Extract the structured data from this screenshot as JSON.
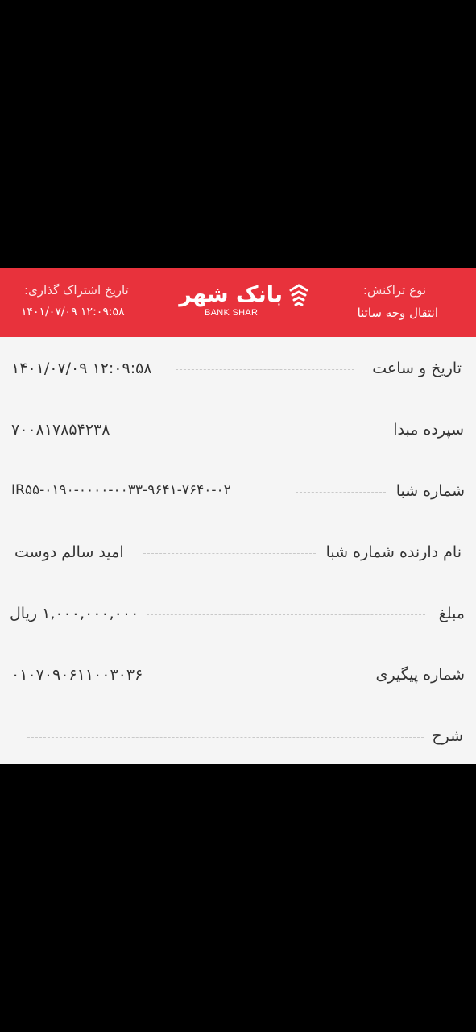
{
  "header": {
    "transaction_type_label": "نوع تراکنش:",
    "transaction_type_value": "انتقال وجه ساتنا",
    "share_date_label": "تاریخ اشتراک گذاری:",
    "share_date_value": "۱۴۰۱/۰۷/۰۹ ۱۲:۰۹:۵۸",
    "logo_fa": "بانک شهر",
    "logo_en": "BANK SHAR",
    "logo_icon": "shahr-bank-logo-icon"
  },
  "rows": [
    {
      "label": "تاریخ و ساعت",
      "value": "۱۴۰۱/۰۷/۰۹ ۱۲:۰۹:۵۸"
    },
    {
      "label": "سپرده مبدا",
      "value": "۷۰۰۸۱۷۸۵۴۲۳۸"
    },
    {
      "label": "شماره شبا",
      "value": "IR۵۵-۰۱۹۰-۰۰۰۰-۰۰۳۳-۹۶۴۱-۷۶۴۰-۰۲"
    },
    {
      "label": "نام دارنده شماره شبا",
      "value": "امید سالم  دوست"
    },
    {
      "label": "مبلغ",
      "value": "۱,۰۰۰,۰۰۰,۰۰۰ ریال"
    },
    {
      "label": "شماره  پیگیری",
      "value": "۰۱۰۷۰۹۰۶۱۱۰۰۳۰۳۶"
    },
    {
      "label": "شرح",
      "value": ""
    }
  ],
  "colors": {
    "accent": "#e8323c",
    "background": "#f5f5f5",
    "frame": "#000000"
  }
}
